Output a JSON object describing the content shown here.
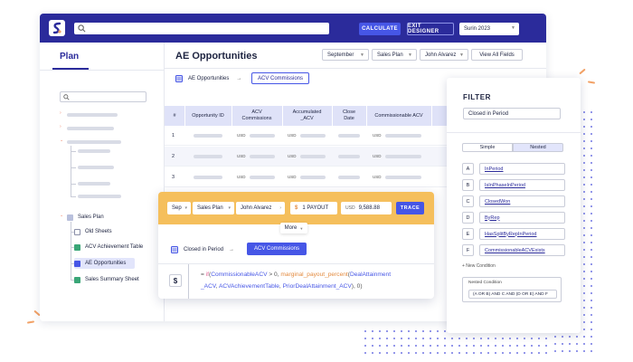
{
  "topbar": {
    "calculate_label": "CALCULATE",
    "exit_designer_label": "EXIT DESIGNER",
    "user_select": "Surin 2023"
  },
  "sidebar": {
    "title": "Plan",
    "tree": [
      {
        "label": "Sales Plan"
      },
      {
        "label": "Old Sheets"
      },
      {
        "label": "ACV Achievement Table"
      },
      {
        "label": "AE Opportunities"
      },
      {
        "label": "Sales Summary Sheet"
      }
    ]
  },
  "main": {
    "title": "AE Opportunities",
    "filters": {
      "month": "September",
      "plan": "Sales Plan",
      "person": "John Alvarez"
    },
    "view_all_label": "View All Fields",
    "breadcrumb": {
      "source": "AE Opportunities",
      "arrow": "→",
      "target": "ACV Commissions"
    },
    "grid": {
      "headers": [
        "#",
        "Opportunity ID",
        "ACV Commissions",
        "Accumulated _ACV",
        "Close Date",
        "Commissionable ACV"
      ],
      "rows": [
        {
          "num": "1",
          "usd": "USD"
        },
        {
          "num": "2",
          "usd": "USD"
        },
        {
          "num": "3",
          "usd": "USD"
        }
      ]
    }
  },
  "formula": {
    "month": "Sep",
    "plan": "Sales Plan",
    "person": "John Alvarez",
    "payout_label": "1 PAYOUT",
    "currency": "USD",
    "amount": "9,588.88",
    "trace_label": "TRACE",
    "more_label": "More",
    "filter_label": "Closed in Period",
    "arrow": "→",
    "target_label": "ACV Commissions",
    "dollar_symbol": "$",
    "code": {
      "p1": "= ",
      "if": "if",
      "p2": "(",
      "var1": "CommissionableACV",
      "p3": " > 0, ",
      "fn1": "marginal_payout_percent",
      "p4": "(",
      "var2": "DealAttainment",
      "line2_var": "_ACV",
      "p5": ", ",
      "var3": "ACVAchievementTable",
      "p6": ", ",
      "var4": "PriorDealAttainment_ACV",
      "p7": "), 0)"
    }
  },
  "filter": {
    "title": "FILTER",
    "input_value": "Closed in Period",
    "mode_simple": "Simple",
    "mode_nested": "Nested",
    "conditions": [
      {
        "letter": "A",
        "label": "InPeriod"
      },
      {
        "letter": "B",
        "label": "IsInPhaseInPeriod"
      },
      {
        "letter": "C",
        "label": "ClosedWon"
      },
      {
        "letter": "D",
        "label": "ByRep"
      },
      {
        "letter": "E",
        "label": "HasSplitByRepInPeriod"
      },
      {
        "letter": "F",
        "label": "CommissionableACVExists"
      }
    ],
    "new_condition_label": "+ New Condition",
    "nested_label": "Nested Condition",
    "nested_expression": "(A OR B) AND C AND (D OR E) AND F"
  },
  "colors": {
    "primary": "#2b2b9b",
    "accent": "#4656e6",
    "highlight": "#f5bf5c",
    "header_bg": "#dfe2f8"
  }
}
